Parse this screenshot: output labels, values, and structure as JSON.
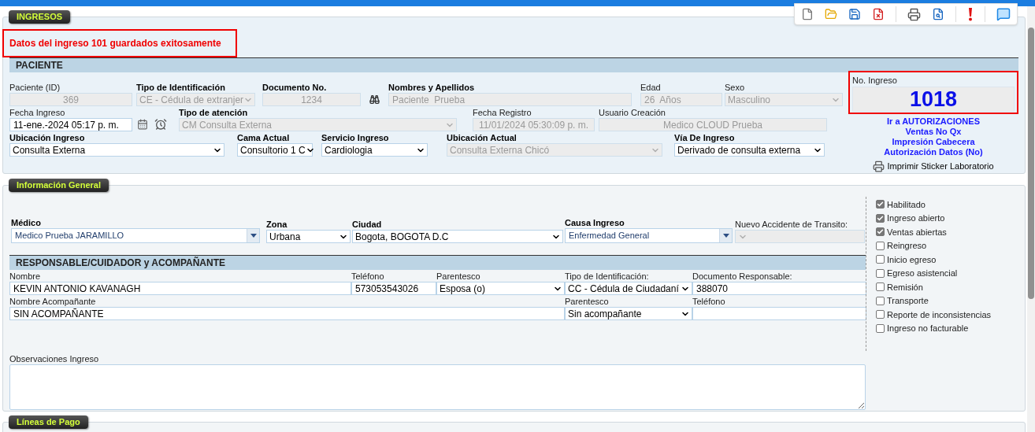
{
  "ingresos": {
    "tab": "INGRESOS",
    "message": "Datos del ingreso 101 guardados exitosamente",
    "paciente": {
      "header": "PACIENTE",
      "fields": [
        {
          "label": "Paciente (ID)",
          "value": "369",
          "kind": "text",
          "disabled": true
        },
        {
          "label": "Tipo de Identificación",
          "value": "CE - Cédula de extranjer",
          "kind": "select",
          "disabled": true
        },
        {
          "label": "Documento No.",
          "value": "1234",
          "kind": "text",
          "disabled": true
        },
        {
          "label": "Nombres y Apellidos",
          "value": "Paciente  Prueba",
          "kind": "text",
          "disabled": true
        },
        {
          "label": "Edad",
          "value": "26  Años",
          "kind": "text",
          "disabled": true
        },
        {
          "label": "Sexo",
          "value": "Masculino",
          "kind": "select",
          "disabled": true
        },
        {
          "label": "Fecha Ingreso",
          "value": "11-ene.-2024 05:17 p. m.",
          "kind": "text",
          "disabled": false
        },
        {
          "label": "Tipo de atención",
          "value": "CM Consulta Externa",
          "kind": "select",
          "disabled": true
        },
        {
          "label": "Fecha Registro",
          "value": "11/01/2024 05:30:09 p. m.",
          "kind": "text",
          "disabled": true
        },
        {
          "label": "Usuario Creación",
          "value": "Medico CLOUD Prueba",
          "kind": "text",
          "disabled": true
        },
        {
          "label": "Ubicación Ingreso",
          "value": "Consulta Externa",
          "kind": "select",
          "disabled": false
        },
        {
          "label": "Cama Actual",
          "value": "Consultorio 1 C",
          "kind": "select",
          "disabled": false
        },
        {
          "label": "Servicio Ingreso",
          "value": "Cardiologia",
          "kind": "select",
          "disabled": false
        },
        {
          "label": "Ubicación Actual",
          "value": "Consulta Externa Chicó",
          "kind": "select",
          "disabled": true
        },
        {
          "label": "Vía De Ingreso",
          "value": "Derivado de consulta externa",
          "kind": "select",
          "disabled": false
        }
      ],
      "no_ingreso": {
        "label": "No. Ingreso",
        "value": "1018"
      },
      "links": [
        "Ir a AUTORIZACIONES",
        "Ventas No Qx",
        "Impresión Cabecera",
        "Autorización Datos (No)"
      ],
      "print_sticker": "Imprimir Sticker Laboratorio"
    }
  },
  "informacion_general": {
    "tab": "Información General",
    "fields": [
      {
        "label": "Médico",
        "value": "Medico Prueba JARAMILLO",
        "kind": "combo",
        "disabled": false
      },
      {
        "label": "Zona",
        "value": "Urbana",
        "kind": "select",
        "disabled": false
      },
      {
        "label": "Ciudad",
        "value": "Bogota, BOGOTA D.C",
        "kind": "select",
        "disabled": false
      },
      {
        "label": "Causa Ingreso",
        "value": "Enfermedad General",
        "kind": "combo",
        "disabled": false
      },
      {
        "label": "Nuevo Accidente de Transito:",
        "kind": "select",
        "disabled": true
      }
    ],
    "responsable": {
      "header": "RESPONSABLE/CUIDADOR y ACOMPAÑANTE",
      "fields": [
        {
          "label": "Nombre",
          "value": "KEVIN ANTONIO KAVANAGH",
          "kind": "text",
          "disabled": false
        },
        {
          "label": "Teléfono",
          "value": "573053543026",
          "kind": "text",
          "disabled": false
        },
        {
          "label": "Parentesco",
          "value": "Esposa (o)",
          "kind": "select",
          "disabled": false
        },
        {
          "label": "Tipo de Identificación:",
          "value": "CC - Cédula de Ciudadaní",
          "kind": "select",
          "disabled": false
        },
        {
          "label": "Documento Responsable:",
          "value": "388070",
          "kind": "text",
          "disabled": false
        },
        {
          "label": "Nombre Acompañante",
          "value": "SIN ACOMPAÑANTE",
          "kind": "text",
          "disabled": false
        },
        {
          "label": "Parentesco",
          "value": "Sin acompañante",
          "kind": "select",
          "disabled": false
        },
        {
          "label": "Teléfono",
          "kind": "text",
          "disabled": false
        }
      ]
    },
    "observaciones": {
      "label": "Observaciones Ingreso"
    },
    "checks": [
      {
        "label": "Habilitado",
        "checked": true
      },
      {
        "label": "Ingreso abierto",
        "checked": true
      },
      {
        "label": "Ventas abiertas",
        "checked": true
      },
      {
        "label": "Reingreso",
        "checked": false
      },
      {
        "label": "Inicio egreso",
        "checked": false
      },
      {
        "label": "Egreso asistencial",
        "checked": false
      },
      {
        "label": "Remisión",
        "checked": false
      },
      {
        "label": "Transporte",
        "checked": false
      },
      {
        "label": "Reporte de inconsistencias",
        "checked": false
      },
      {
        "label": "Ingreso no facturable",
        "checked": false
      }
    ]
  },
  "lineas_de_pago": {
    "tab": "Líneas de Pago"
  }
}
